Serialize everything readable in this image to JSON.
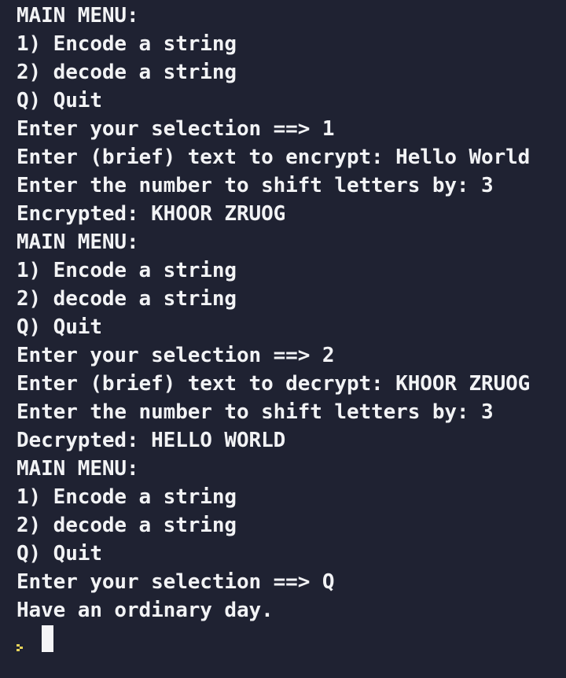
{
  "terminal": {
    "lines": [
      "MAIN MENU:",
      "1) Encode a string",
      "2) decode a string",
      "Q) Quit",
      "Enter your selection ==> 1",
      "Enter (brief) text to encrypt: Hello World",
      "Enter the number to shift letters by: 3",
      "Encrypted: KHOOR ZRUOG",
      "MAIN MENU:",
      "1) Encode a string",
      "2) decode a string",
      "Q) Quit",
      "Enter your selection ==> 2",
      "Enter (brief) text to decrypt: KHOOR ZRUOG",
      "Enter the number to shift letters by: 3",
      "Decrypted: HELLO WORLD",
      "MAIN MENU:",
      "1) Encode a string",
      "2) decode a string",
      "Q) Quit",
      "Enter your selection ==> Q",
      "Have an ordinary day."
    ],
    "prompt_icon": "chevron-right-icon",
    "prompt_color": "#e6d35a",
    "background": "#1f2232",
    "foreground": "#f2f3f5"
  }
}
